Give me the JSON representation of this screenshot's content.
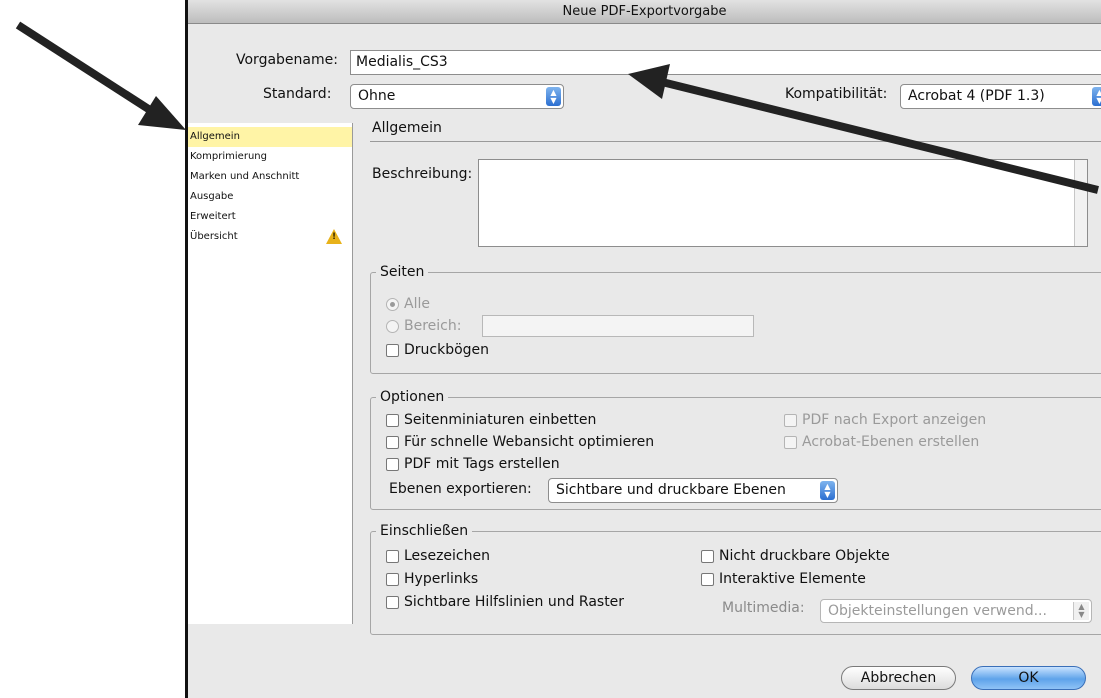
{
  "window": {
    "title": "Neue PDF-Exportvorgabe"
  },
  "preset": {
    "label": "Vorgabename:",
    "value": "Medialis_CS3"
  },
  "standard": {
    "label": "Standard:",
    "value": "Ohne"
  },
  "compat": {
    "label": "Kompatibilität:",
    "value": "Acrobat 4 (PDF 1.3)"
  },
  "sidebar": {
    "items": [
      {
        "label": "Allgemein",
        "selected": true
      },
      {
        "label": "Komprimierung"
      },
      {
        "label": "Marken und Anschnitt"
      },
      {
        "label": "Ausgabe"
      },
      {
        "label": "Erweitert"
      },
      {
        "label": "Übersicht",
        "icon": "warning-icon"
      }
    ]
  },
  "main": {
    "section_title": "Allgemein",
    "description_label": "Beschreibung:",
    "pages": {
      "title": "Seiten",
      "all": "Alle",
      "range": "Bereich:",
      "spreads": "Druckbögen"
    },
    "options": {
      "title": "Optionen",
      "thumbnails": "Seitenminiaturen einbetten",
      "fast_web": "Für schnelle Webansicht optimieren",
      "tagged": "PDF mit Tags erstellen",
      "view_after": "PDF nach Export anzeigen",
      "acrobat_layers": "Acrobat-Ebenen erstellen",
      "export_layers_label": "Ebenen exportieren:",
      "export_layers_value": "Sichtbare und druckbare Ebenen"
    },
    "include": {
      "title": "Einschließen",
      "bookmarks": "Lesezeichen",
      "hyperlinks": "Hyperlinks",
      "guides": "Sichtbare Hilfslinien und Raster",
      "nonprinting": "Nicht druckbare Objekte",
      "interactive": "Interaktive Elemente",
      "multimedia_label": "Multimedia:",
      "multimedia_value": "Objekteinstellungen verwend..."
    }
  },
  "buttons": {
    "cancel": "Abbrechen",
    "ok": "OK"
  },
  "colors": {
    "selection": "#fff4a6",
    "accent": "#5ea3ea",
    "warning": "#e8b21a"
  }
}
